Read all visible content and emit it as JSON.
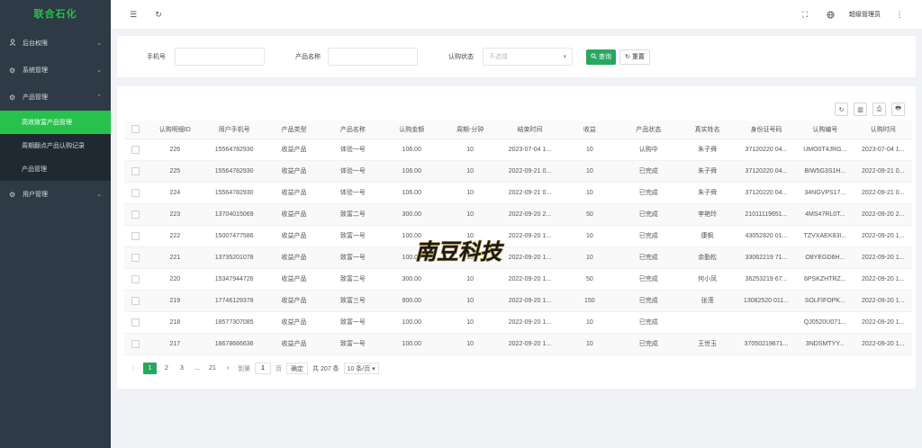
{
  "sidebar": {
    "logo": "联合石化",
    "menu": [
      {
        "label": "后台权限",
        "icon": "user-icon"
      },
      {
        "label": "系统管理",
        "icon": "gear-icon"
      },
      {
        "label": "产品管理",
        "icon": "gear-icon"
      },
      {
        "label": "用户管理",
        "icon": "gear-icon"
      }
    ],
    "submenu": [
      "高效致富产品管理",
      "周期翻点产品认购记录",
      "产品管理"
    ]
  },
  "header": {
    "user": "超级管理员"
  },
  "search": {
    "phone_label": "手机号",
    "phone_value": "",
    "product_label": "产品名称",
    "product_value": "",
    "status_label": "认购状态",
    "status_placeholder": "不选择",
    "search_button": "查询",
    "reset_button": "重置"
  },
  "table": {
    "columns": [
      "认购明细ID",
      "用户手机号",
      "产品类型",
      "产品名称",
      "认购金额",
      "周期-分钟",
      "结束时间",
      "收益",
      "产品状态",
      "真实姓名",
      "身份证号码",
      "认购编号",
      "认购时间"
    ],
    "rows": [
      [
        "226",
        "15564782930",
        "收益产品",
        "体验一号",
        "106.00",
        "10",
        "2023-07-04 1...",
        "10",
        "认购中",
        "朱子舜",
        "37120220 04...",
        "UMO0T4JRG...",
        "2023-07-04 1..."
      ],
      [
        "225",
        "15564782930",
        "收益产品",
        "体验一号",
        "106.00",
        "10",
        "2022-09-21 0...",
        "10",
        "已完成",
        "朱子舜",
        "37120220 04...",
        "BIW5G3S1H...",
        "2022-09-21 0..."
      ],
      [
        "224",
        "15564782930",
        "收益产品",
        "体验一号",
        "106.00",
        "10",
        "2022-09-21 0...",
        "10",
        "已完成",
        "朱子舜",
        "37120220 04...",
        "34NGVPS17...",
        "2022-09-21 0..."
      ],
      [
        "223",
        "13704015069",
        "收益产品",
        "致富二号",
        "300.00",
        "10",
        "2022-09-20 2...",
        "50",
        "已完成",
        "李艳玲",
        "21011119651...",
        "4MS47RL0T...",
        "2022-09-20 2..."
      ],
      [
        "222",
        "15007477586",
        "收益产品",
        "致富一号",
        "100.00",
        "10",
        "2022-09-20 1...",
        "10",
        "已完成",
        "康枫",
        "43052820 01...",
        "TZVXAEK83I...",
        "2022-09-20 1..."
      ],
      [
        "221",
        "13735201078",
        "收益产品",
        "致富一号",
        "100.00",
        "10",
        "2022-09-20 1...",
        "10",
        "已完成",
        "余勤松",
        "33062219 71...",
        "O8YEGD6H...",
        "2022-09-20 1..."
      ],
      [
        "220",
        "15347944726",
        "收益产品",
        "致富二号",
        "300.00",
        "10",
        "2022-09-20 1...",
        "50",
        "已完成",
        "何小凤",
        "36253219 67...",
        "6PSKZHTRZ...",
        "2022-09-20 1..."
      ],
      [
        "219",
        "17746129378",
        "收益产品",
        "致富三号",
        "900.00",
        "10",
        "2022-09-20 1...",
        "150",
        "已完成",
        "张滢",
        "13082520 011...",
        "SOLFIFOPK...",
        "2022-09-20 1..."
      ],
      [
        "218",
        "18577307085",
        "收益产品",
        "致富一号",
        "100.00",
        "10",
        "2022-09-20 1...",
        "10",
        "已完成",
        "",
        "",
        "QJ0520U071...",
        "2022-09-20 1..."
      ],
      [
        "217",
        "18678666636",
        "收益产品",
        "致富一号",
        "100.00",
        "10",
        "2022-09-20 1...",
        "10",
        "已完成",
        "王世玉",
        "37050219671...",
        "3NDSMTYY...",
        "2022-09-20 1..."
      ]
    ]
  },
  "pager": {
    "pages": [
      "1",
      "2",
      "3",
      "...",
      "21"
    ],
    "goto_label": "到第",
    "goto_value": "1",
    "page_unit": "页",
    "confirm": "确定",
    "total": "共 207 条",
    "page_size": "10 条/页"
  },
  "watermark": {
    "text": "南豆科技"
  },
  "colors": {
    "sidebar_bg": "#2e3a45",
    "accent": "#27c24c",
    "button_green": "#27a85f"
  }
}
